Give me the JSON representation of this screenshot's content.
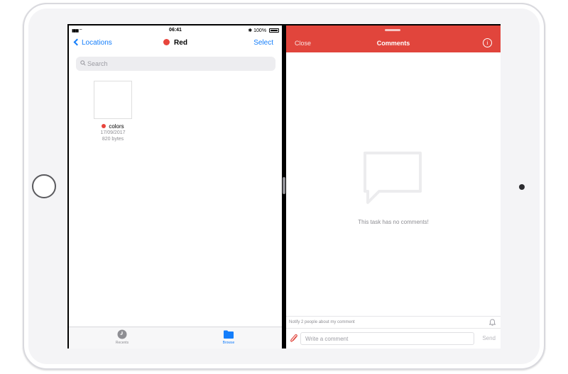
{
  "status_bar": {
    "time": "06:41",
    "battery_text": "100%"
  },
  "files": {
    "nav": {
      "back_label": "Locations",
      "title": "Red",
      "select_label": "Select"
    },
    "search": {
      "placeholder": "Search"
    },
    "items": [
      {
        "name": "colors",
        "date": "17/09/2017",
        "size": "820 bytes"
      }
    ],
    "tabs": [
      {
        "label": "Recents",
        "icon": "clock-icon"
      },
      {
        "label": "Browse",
        "icon": "folder-icon"
      }
    ]
  },
  "comments": {
    "close_label": "Close",
    "title": "Comments",
    "empty_message": "This task has no comments!",
    "notify_text": "Notify 2 people about my comment",
    "input_placeholder": "Write a comment",
    "send_label": "Send"
  },
  "colors": {
    "accent_red": "#e1453c",
    "tag_red": "#e8453c",
    "ios_blue": "#147efb"
  }
}
